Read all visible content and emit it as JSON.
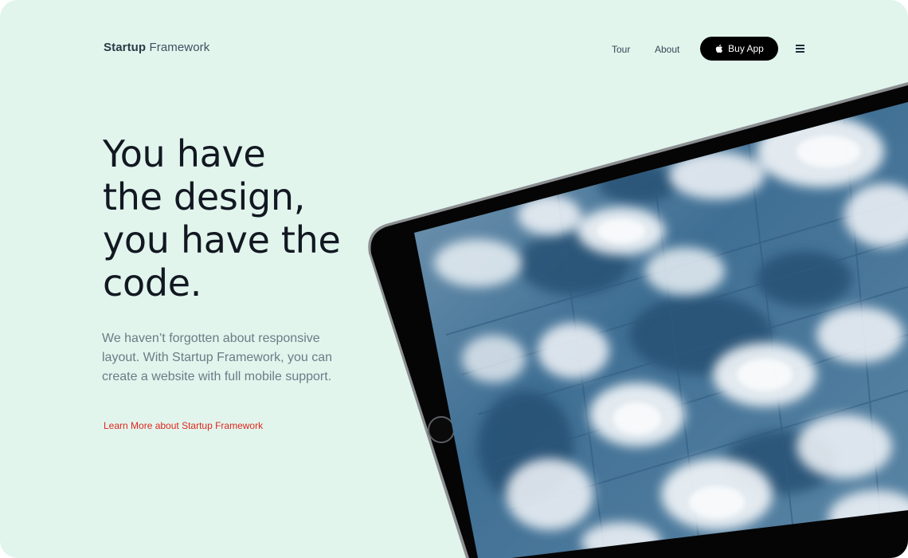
{
  "brand": {
    "bold": "Startup",
    "light": " Framework"
  },
  "nav": {
    "tour_label": "Tour",
    "about_label": "About",
    "buy_label": "Buy App",
    "buy_icon": "apple-icon",
    "menu_icon": "menu-icon"
  },
  "hero": {
    "headline_lines": [
      "You have",
      "the design,",
      "you have the",
      "code."
    ],
    "subtext_lines": [
      "We haven’t forgotten about responsive",
      "layout. With Startup Framework, you can",
      "create a website with full mobile support."
    ],
    "learn_more": "Learn More about Startup Framework"
  },
  "colors": {
    "background": "#e1f5ed",
    "accent_link": "#e0261b",
    "button_bg": "#000000"
  }
}
